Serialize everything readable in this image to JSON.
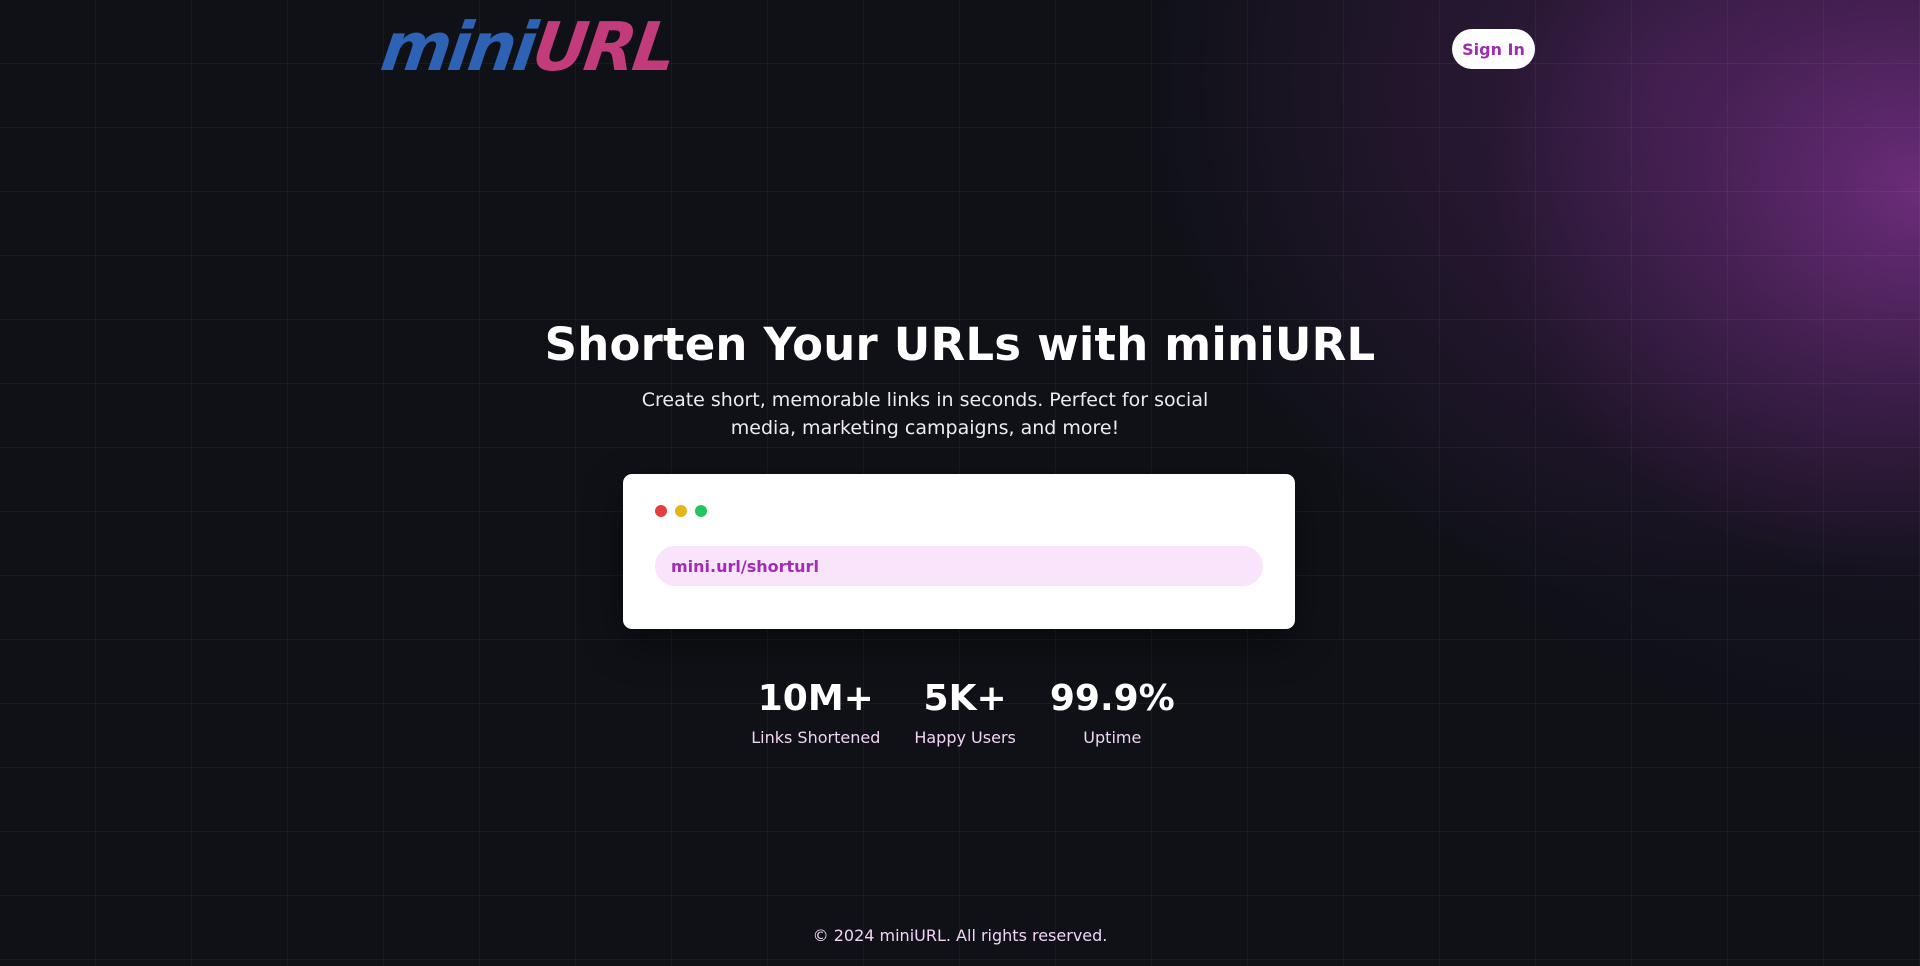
{
  "header": {
    "logo_part1": "mini",
    "logo_part2": "URL",
    "signin_label": "Sign In"
  },
  "hero": {
    "title": "Shorten Your URLs with miniURL",
    "subtitle": "Create short, memorable links in seconds. Perfect for social media, marketing campaigns, and more!"
  },
  "demo_card": {
    "url_text": "mini.url/shorturl"
  },
  "stats": [
    {
      "value": "10M+",
      "label": "Links Shortened"
    },
    {
      "value": "5K+",
      "label": "Happy Users"
    },
    {
      "value": "99.9%",
      "label": "Uptime"
    }
  ],
  "footer": {
    "copyright": "© 2024 miniURL. All rights reserved."
  },
  "colors": {
    "background": "#0f1117",
    "accent_purple": "#a02db0",
    "logo_blue": "#2e62b5",
    "logo_pink": "#c23c7c",
    "url_bar_bg": "#f9e4fb"
  }
}
